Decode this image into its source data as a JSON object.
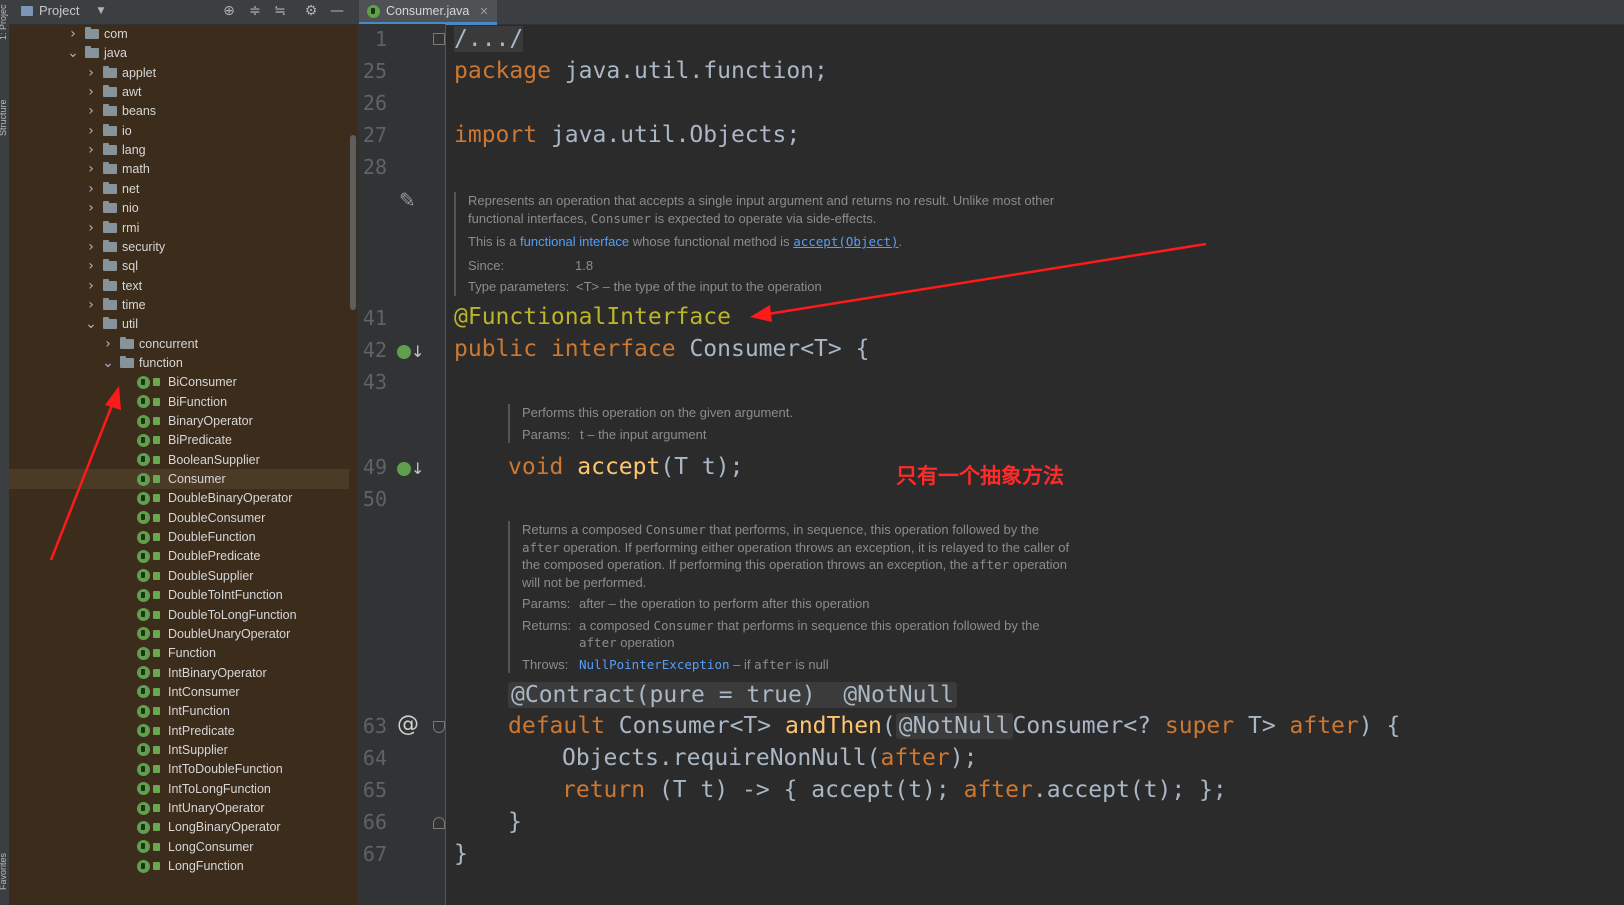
{
  "window": {
    "project_label": "Project",
    "side_strip_top": "1: Project",
    "side_strip_mid": "Structure",
    "side_strip_bottom": "Favorites"
  },
  "icons": {
    "toolbar": [
      "locate-icon",
      "expand-all-icon",
      "collapse-all-icon",
      "gear-icon",
      "minimize-icon"
    ]
  },
  "tree": {
    "rows": [
      {
        "label": "com",
        "kind": "folder",
        "expanded": false,
        "depth": 0
      },
      {
        "label": "java",
        "kind": "folder",
        "expanded": true,
        "depth": 0
      },
      {
        "label": "applet",
        "kind": "folder",
        "expanded": false,
        "depth": 1
      },
      {
        "label": "awt",
        "kind": "folder",
        "expanded": false,
        "depth": 1
      },
      {
        "label": "beans",
        "kind": "folder",
        "expanded": false,
        "depth": 1
      },
      {
        "label": "io",
        "kind": "folder",
        "expanded": false,
        "depth": 1
      },
      {
        "label": "lang",
        "kind": "folder",
        "expanded": false,
        "depth": 1
      },
      {
        "label": "math",
        "kind": "folder",
        "expanded": false,
        "depth": 1
      },
      {
        "label": "net",
        "kind": "folder",
        "expanded": false,
        "depth": 1
      },
      {
        "label": "nio",
        "kind": "folder",
        "expanded": false,
        "depth": 1
      },
      {
        "label": "rmi",
        "kind": "folder",
        "expanded": false,
        "depth": 1
      },
      {
        "label": "security",
        "kind": "folder",
        "expanded": false,
        "depth": 1
      },
      {
        "label": "sql",
        "kind": "folder",
        "expanded": false,
        "depth": 1
      },
      {
        "label": "text",
        "kind": "folder",
        "expanded": false,
        "depth": 1
      },
      {
        "label": "time",
        "kind": "folder",
        "expanded": false,
        "depth": 1
      },
      {
        "label": "util",
        "kind": "folder",
        "expanded": true,
        "depth": 1
      },
      {
        "label": "concurrent",
        "kind": "folder",
        "expanded": false,
        "depth": 2
      },
      {
        "label": "function",
        "kind": "folder",
        "expanded": true,
        "depth": 2
      },
      {
        "label": "BiConsumer",
        "kind": "class",
        "depth": 3
      },
      {
        "label": "BiFunction",
        "kind": "class",
        "depth": 3
      },
      {
        "label": "BinaryOperator",
        "kind": "class",
        "depth": 3
      },
      {
        "label": "BiPredicate",
        "kind": "class",
        "depth": 3
      },
      {
        "label": "BooleanSupplier",
        "kind": "class",
        "depth": 3
      },
      {
        "label": "Consumer",
        "kind": "class",
        "depth": 3,
        "selected": true
      },
      {
        "label": "DoubleBinaryOperator",
        "kind": "class",
        "depth": 3
      },
      {
        "label": "DoubleConsumer",
        "kind": "class",
        "depth": 3
      },
      {
        "label": "DoubleFunction",
        "kind": "class",
        "depth": 3
      },
      {
        "label": "DoublePredicate",
        "kind": "class",
        "depth": 3
      },
      {
        "label": "DoubleSupplier",
        "kind": "class",
        "depth": 3
      },
      {
        "label": "DoubleToIntFunction",
        "kind": "class",
        "depth": 3
      },
      {
        "label": "DoubleToLongFunction",
        "kind": "class",
        "depth": 3
      },
      {
        "label": "DoubleUnaryOperator",
        "kind": "class",
        "depth": 3
      },
      {
        "label": "Function",
        "kind": "class",
        "depth": 3
      },
      {
        "label": "IntBinaryOperator",
        "kind": "class",
        "depth": 3
      },
      {
        "label": "IntConsumer",
        "kind": "class",
        "depth": 3
      },
      {
        "label": "IntFunction",
        "kind": "class",
        "depth": 3
      },
      {
        "label": "IntPredicate",
        "kind": "class",
        "depth": 3
      },
      {
        "label": "IntSupplier",
        "kind": "class",
        "depth": 3
      },
      {
        "label": "IntToDoubleFunction",
        "kind": "class",
        "depth": 3
      },
      {
        "label": "IntToLongFunction",
        "kind": "class",
        "depth": 3
      },
      {
        "label": "IntUnaryOperator",
        "kind": "class",
        "depth": 3
      },
      {
        "label": "LongBinaryOperator",
        "kind": "class",
        "depth": 3
      },
      {
        "label": "LongConsumer",
        "kind": "class",
        "depth": 3
      },
      {
        "label": "LongFunction",
        "kind": "class",
        "depth": 3
      }
    ]
  },
  "editor": {
    "tab_label": "Consumer.java",
    "line_numbers": {
      "l1": "1",
      "l25": "25",
      "l26": "26",
      "l27": "27",
      "l28": "28",
      "l41": "41",
      "l42": "42",
      "l43": "43",
      "l49": "49",
      "l50": "50",
      "l63": "63",
      "l64": "64",
      "l65": "65",
      "l66": "66",
      "l67": "67"
    },
    "gutter_at": "@",
    "code": {
      "folded_header": "/.../",
      "pkg_kw": "package",
      "pkg_name": " java.util.function;",
      "imp_kw": "import",
      "imp_name": " java.util.Objects;",
      "annotation": "@FunctionalInterface",
      "decl_public": "public",
      "decl_interface": "interface",
      "decl_name": "Consumer<T> {",
      "void_kw": "void",
      "accept_fn": "accept",
      "accept_rest": "(T t);",
      "contract_inlay": "@Contract(pure = true)  @NotNull",
      "default_kw": "default",
      "default_type": "Consumer<T> ",
      "andthen_fn": "andThen",
      "paren_open": "(",
      "notnull_inlay": "@NotNull",
      "param_part1": "Consumer<? ",
      "super_kw": "super",
      "param_part2": " T> ",
      "after_param": "after",
      "param_close": ") {",
      "req_obj": "Objects.",
      "req_fn": "requireNonNull",
      "req_rest_open": "(",
      "req_after": "after",
      "req_rest_close": ");",
      "ret_kw": "return",
      "ret_part1": " (T t) -> { ",
      "ret_accept": "accept",
      "ret_part2": "(t); ",
      "ret_after": "after",
      "ret_dot": ".",
      "ret_accept2": "accept",
      "ret_part3": "(t); };",
      "close_inner": "}",
      "close_outer": "}"
    },
    "doc1": {
      "line1": "Represents an operation that accepts a single input argument and returns no result. Unlike most other",
      "line2_a": "functional interfaces, ",
      "line2_mono": "Consumer",
      "line2_b": " is expected to operate via side-effects.",
      "line3_a": "This is a ",
      "line3_link": "functional interface",
      "line3_b": " whose functional method is ",
      "line3_ulink": "accept(Object)",
      "line3_c": ".",
      "since_label": "Since:",
      "since_value": "1.8",
      "tparam_label": "Type parameters:",
      "tparam_value": "<T> – the type of the input to the operation"
    },
    "doc2": {
      "line1": "Performs this operation on the given argument.",
      "params_label": "Params:",
      "params_value": "t – the input argument"
    },
    "doc3": {
      "l1_a": "Returns a composed ",
      "l1_mono": "Consumer",
      "l1_b": " that performs, in sequence, this operation followed by the",
      "l2_mono": "after",
      "l2_b": " operation. If performing either operation throws an exception, it is relayed to the caller of",
      "l3_a": "the composed operation. If performing this operation throws an exception, the ",
      "l3_mono": "after",
      "l3_b": " operation",
      "l4": "will not be performed.",
      "params_label": "Params:",
      "params_value": "after – the operation to perform after this operation",
      "returns_label": "Returns:",
      "returns_a": "a composed ",
      "returns_mono": "Consumer",
      "returns_b": " that performs in sequence this operation followed by the",
      "returns_l2_mono": "after",
      "returns_l2_b": " operation",
      "throws_label": "Throws:",
      "throws_link": "NullPointerException",
      "throws_rest_a": " – if ",
      "throws_mono": "after",
      "throws_rest_b": " is null"
    },
    "note_text": "只有一个抽象方法"
  }
}
